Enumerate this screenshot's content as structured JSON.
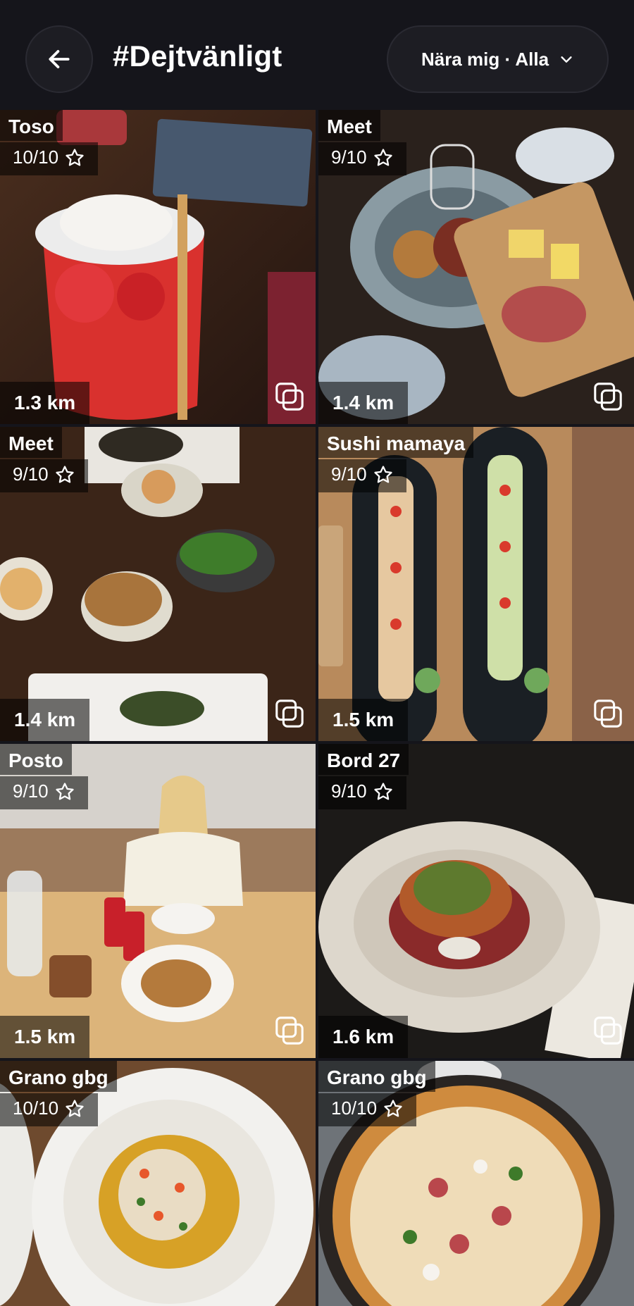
{
  "header": {
    "title": "#Dejtvänligt",
    "filter_label": "Nära mig · Alla"
  },
  "tiles": [
    {
      "name": "Toso",
      "rating": "10/10",
      "distance": "1.3 km"
    },
    {
      "name": "Meet",
      "rating": "9/10",
      "distance": "1.4 km"
    },
    {
      "name": "Meet",
      "rating": "9/10",
      "distance": "1.4 km"
    },
    {
      "name": "Sushi mamaya",
      "rating": "9/10",
      "distance": "1.5 km"
    },
    {
      "name": "Posto",
      "rating": "9/10",
      "distance": "1.5 km"
    },
    {
      "name": "Bord 27",
      "rating": "9/10",
      "distance": "1.6 km"
    },
    {
      "name": "Grano gbg",
      "rating": "10/10",
      "distance": ""
    },
    {
      "name": "Grano gbg",
      "rating": "10/10",
      "distance": ""
    }
  ]
}
